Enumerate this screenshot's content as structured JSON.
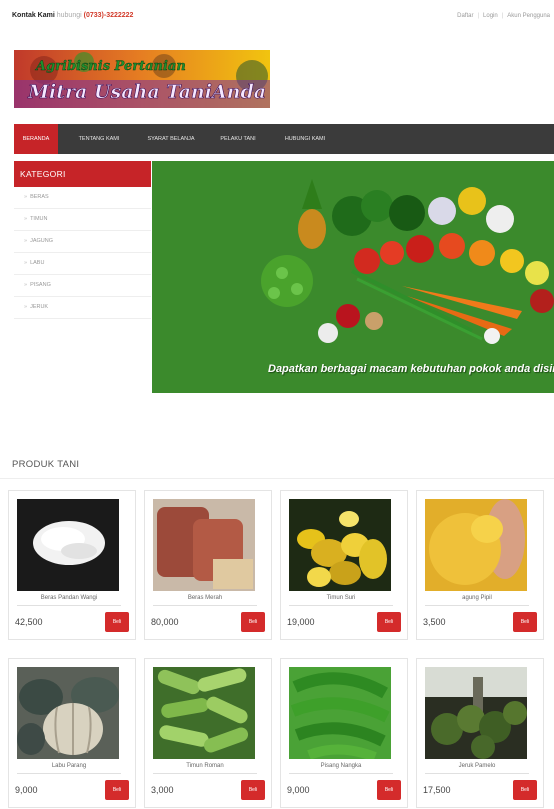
{
  "topbar": {
    "contact_label": "Kontak Kami",
    "contact_muted": "hubungi",
    "phone": "(0733)-3222222",
    "links": [
      "Daftar",
      "Login",
      "Akun Pengguna"
    ]
  },
  "logo": {
    "line1": "Agribisnis Pertanian",
    "line2": "Mitra Usaha TaniAnda"
  },
  "nav": {
    "items": [
      "BERANDA",
      "TENTANG KAMI",
      "SYARAT BELANJA",
      "PELAKU TANI",
      "HUBUNGI KAMI"
    ],
    "active_index": 0
  },
  "sidebar": {
    "heading": "KATEGORI",
    "items": [
      "BERAS",
      "TIMUN",
      "JAGUNG",
      "LABU",
      "PISANG",
      "JERUK"
    ]
  },
  "banner": {
    "caption": "Dapatkan berbagai macam kebutuhan pokok anda disini"
  },
  "products": {
    "heading": "PRODUK TANI",
    "buy_label": "Beli",
    "items": [
      {
        "name": "Beras Pandan Wangi",
        "price": "42,500",
        "image": "rice-image"
      },
      {
        "name": "Beras Merah",
        "price": "80,000",
        "image": "red-rice-image"
      },
      {
        "name": "Timun Suri",
        "price": "19,000",
        "image": "timun-suri-image"
      },
      {
        "name": "agung Pipil",
        "price": "3,500",
        "image": "corn-kernels-image"
      },
      {
        "name": "Labu Parang",
        "price": "9,000",
        "image": "pumpkin-image"
      },
      {
        "name": "Timun Roman",
        "price": "3,000",
        "image": "cucumber-image"
      },
      {
        "name": "Pisang Nangka",
        "price": "9,000",
        "image": "banana-image"
      },
      {
        "name": "Jeruk Pamelo",
        "price": "17,500",
        "image": "pomelo-image"
      }
    ]
  },
  "colors": {
    "accent_red": "#c62428",
    "nav_bg": "#3b3b3b",
    "banner_green": "#3b8a2c"
  }
}
